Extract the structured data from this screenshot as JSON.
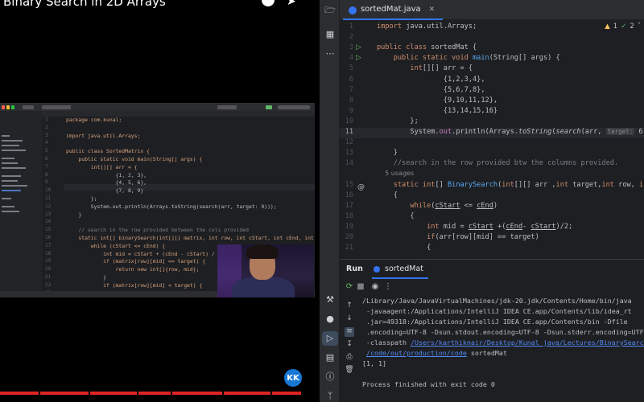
{
  "video": {
    "title": "Binary Search in 2D Arrays",
    "channel_logo_text": "KK",
    "frame": {
      "lines": [
        {
          "n": "1",
          "code": "package com.kunal;"
        },
        {
          "n": "2",
          "code": ""
        },
        {
          "n": "3",
          "code": "import java.util.Arrays;"
        },
        {
          "n": "4",
          "code": ""
        },
        {
          "n": "5",
          "code": "public class SortedMatrix {"
        },
        {
          "n": "6",
          "code": "    public static void main(String[] args) {"
        },
        {
          "n": "7",
          "code": "        int[][] arr = {"
        },
        {
          "n": "8",
          "code": "                {1, 2, 3},"
        },
        {
          "n": "9",
          "code": "                {4, 5, 6},"
        },
        {
          "n": "10",
          "code": "                {7, 8, 9}"
        },
        {
          "n": "11",
          "code": "        };"
        },
        {
          "n": "12",
          "code": "        System.out.println(Arrays.toString(search(arr, target: 9)));"
        },
        {
          "n": "13",
          "code": "    }"
        },
        {
          "n": "14",
          "code": ""
        },
        {
          "n": "15",
          "code": "    // search in the row provided between the cols provided"
        },
        {
          "n": "16",
          "code": "    static int[] binarySearch(int[][] matrix, int row, int cStart, int cEnd, int ta"
        },
        {
          "n": "17",
          "code": "        while (cStart <= cEnd) {"
        },
        {
          "n": "18",
          "code": "            int mid = cStart + (cEnd - cStart) / 2;"
        },
        {
          "n": "19",
          "code": "            if (matrix[row][mid] == target) {"
        },
        {
          "n": "20",
          "code": "                return new int[]{row, mid};"
        },
        {
          "n": "21",
          "code": "            }"
        },
        {
          "n": "22",
          "code": "            if (matrix[row][mid] < target) {"
        },
        {
          "n": "23",
          "code": "                cStart = mid + 1;"
        }
      ]
    }
  },
  "ide": {
    "tab": {
      "label": "sortedMat.java"
    },
    "inspections": {
      "warnings": "1",
      "weak": "2"
    },
    "editor_lines": [
      {
        "n": "1",
        "segments": [
          [
            "kw",
            "import "
          ],
          [
            "",
            "java.util.Arrays;"
          ]
        ]
      },
      {
        "n": "2",
        "segments": []
      },
      {
        "n": "3",
        "segments": [
          [
            "kw",
            "public class "
          ],
          [
            "",
            "sortedMat {"
          ]
        ]
      },
      {
        "n": "4",
        "segments": [
          [
            "kw",
            "    public static void "
          ],
          [
            "fn",
            "main"
          ],
          [
            "",
            "(String[] args) {"
          ]
        ]
      },
      {
        "n": "5",
        "segments": [
          [
            "kw",
            "        int"
          ],
          [
            "",
            "[][] arr = {"
          ]
        ]
      },
      {
        "n": "6",
        "segments": [
          [
            "",
            "                {1,2,3,4},"
          ]
        ]
      },
      {
        "n": "7",
        "segments": [
          [
            "",
            "                {5,6,7,8},"
          ]
        ]
      },
      {
        "n": "8",
        "segments": [
          [
            "",
            "                {9,10,11,12},"
          ]
        ]
      },
      {
        "n": "9",
        "segments": [
          [
            "",
            "                {13,14,15,16}"
          ]
        ]
      },
      {
        "n": "10",
        "segments": [
          [
            "",
            "        };"
          ]
        ]
      },
      {
        "n": "11",
        "segments": [
          [
            "",
            "        System."
          ],
          [
            "pu",
            "out"
          ],
          [
            "",
            ".println(Arrays."
          ],
          [
            "ital",
            "toString"
          ],
          [
            "",
            "("
          ],
          [
            "ital",
            "search"
          ],
          [
            "",
            "(arr, "
          ],
          [
            "hint",
            "target:"
          ],
          [
            "",
            " 6)));"
          ]
        ]
      },
      {
        "n": "12",
        "segments": []
      },
      {
        "n": "13",
        "segments": [
          [
            "",
            "    }"
          ]
        ]
      },
      {
        "n": "14",
        "segments": [
          [
            "cm",
            "    //search in the row provided btw the columns provided."
          ]
        ]
      },
      {
        "n": "",
        "segments": [
          [
            "usages",
            "    5 usages"
          ]
        ]
      },
      {
        "n": "15",
        "segments": [
          [
            "kw",
            "    static int"
          ],
          [
            "",
            "[] "
          ],
          [
            "fn",
            "BinarySearch"
          ],
          [
            "",
            "("
          ],
          [
            "kw",
            "int"
          ],
          [
            "",
            "[][] arr ,"
          ],
          [
            "kw",
            "int "
          ],
          [
            "",
            "target,"
          ],
          [
            "kw",
            "int "
          ],
          [
            "",
            "row, "
          ],
          [
            "kw",
            "int "
          ],
          [
            "",
            "cSt"
          ]
        ]
      },
      {
        "n": "16",
        "segments": [
          [
            "",
            "    {"
          ]
        ]
      },
      {
        "n": "17",
        "segments": [
          [
            "kw",
            "        while"
          ],
          [
            "",
            "("
          ],
          [
            "ul",
            "cStart"
          ],
          [
            "",
            " <= "
          ],
          [
            "ul",
            "cEnd"
          ],
          [
            "",
            ")"
          ]
        ]
      },
      {
        "n": "18",
        "segments": [
          [
            "",
            "        {"
          ]
        ]
      },
      {
        "n": "19",
        "segments": [
          [
            "kw",
            "            int "
          ],
          [
            "",
            "mid = "
          ],
          [
            "ul",
            "cStart"
          ],
          [
            "",
            " +("
          ],
          [
            "ul",
            "cEnd"
          ],
          [
            "",
            "- "
          ],
          [
            "ul",
            "cStart"
          ],
          [
            "",
            ")/2;"
          ]
        ]
      },
      {
        "n": "20",
        "segments": [
          [
            "kw",
            "            if"
          ],
          [
            "",
            "(arr[row][mid] == target)"
          ]
        ]
      },
      {
        "n": "21",
        "segments": [
          [
            "",
            "            {"
          ]
        ]
      }
    ],
    "run": {
      "title": "Run",
      "tab_label": "sortedMat",
      "console": [
        "/Library/Java/JavaVirtualMachines/jdk-20.jdk/Contents/Home/bin/java",
        " -javaagent:/Applications/IntelliJ IDEA CE.app/Contents/lib/idea_rt",
        " .jar=49318:/Applications/IntelliJ IDEA CE.app/Contents/bin -Dfile",
        " .encoding=UTF-8 -Dsun.stdout.encoding=UTF-8 -Dsun.stderr.encoding=UTF-8",
        " -classpath ",
        "[1, 1]",
        "",
        "Process finished with exit code 0"
      ],
      "classpath_link_1": "/Users/karthiknair/Desktop/Kunal java/Lectures/BinarySearch",
      "classpath_link_2": "/code/out/production/code",
      "main_class": " sortedMat"
    }
  }
}
